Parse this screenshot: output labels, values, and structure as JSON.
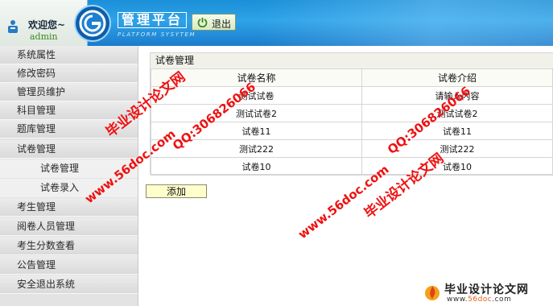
{
  "header": {
    "welcome": "欢迎您~",
    "username": "admin",
    "brand_title": "管理平台",
    "brand_subtitle": "PLATFORM SYSYTEM",
    "logout_label": "退出"
  },
  "sidebar": {
    "items": [
      {
        "label": "系统属性"
      },
      {
        "label": "修改密码"
      },
      {
        "label": "管理员维护"
      },
      {
        "label": "科目管理"
      },
      {
        "label": "题库管理"
      },
      {
        "label": "试卷管理"
      }
    ],
    "subitems": [
      {
        "label": "试卷管理"
      },
      {
        "label": "试卷录入"
      }
    ],
    "items_after": [
      {
        "label": "考生管理"
      },
      {
        "label": "阅卷人员管理"
      },
      {
        "label": "考生分数查看"
      },
      {
        "label": "公告管理"
      },
      {
        "label": "安全退出系统"
      }
    ]
  },
  "main": {
    "panel_title": "试卷管理",
    "table": {
      "columns": [
        "试卷名称",
        "试卷介绍"
      ],
      "rows": [
        [
          "测试试卷",
          "请输入内容"
        ],
        [
          "测试试卷2",
          "测试试卷2"
        ],
        [
          "试卷11",
          "试卷11"
        ],
        [
          "测试222",
          "测试222"
        ],
        [
          "试卷10",
          "试卷10"
        ]
      ]
    },
    "add_label": "添加"
  },
  "watermarks": {
    "site_cn": "毕业设计论文网",
    "qq": "QQ:306826066",
    "url": "www.56doc.com"
  },
  "footer_logo": {
    "cn": "毕业设计论文网",
    "url_prefix": "www.",
    "url_accent": "56doc",
    "url_suffix": ".com"
  },
  "colors": {
    "header_blue": "#1b8fd8",
    "sidebar_gray": "#e3e3e3",
    "add_button_bg": "#ffffcc",
    "watermark_red": "#ee1111"
  }
}
